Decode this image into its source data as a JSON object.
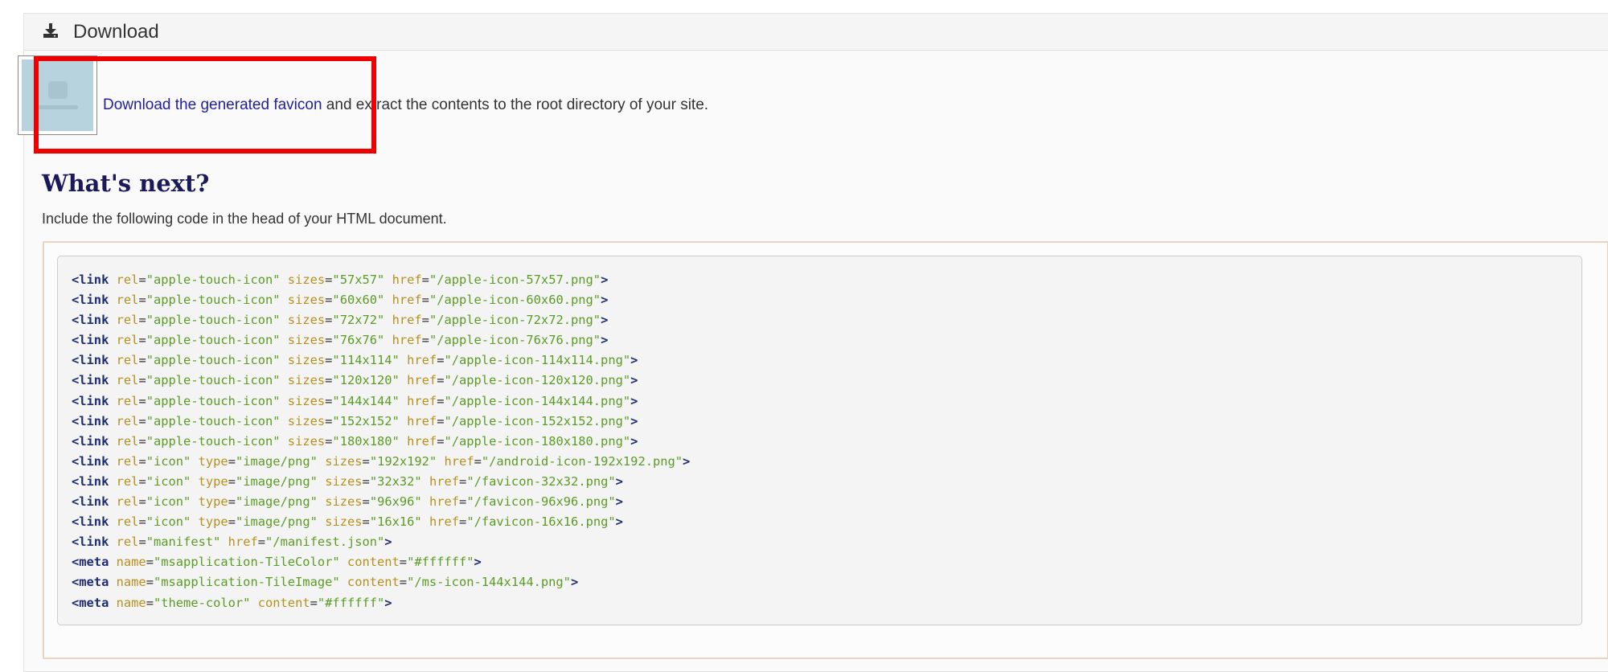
{
  "panel": {
    "icon": "download-icon",
    "title": "Download"
  },
  "download": {
    "link_text": "Download the generated favicon",
    "rest_text": " and extract the contents to the root directory of your site.",
    "thumbnail": "favicon-package-thumbnail"
  },
  "next": {
    "heading": "What's next?",
    "intro": "Include the following code in the head of your HTML document."
  },
  "code_lines": [
    {
      "tag": "link",
      "attrs": [
        [
          "rel",
          "apple-touch-icon"
        ],
        [
          "sizes",
          "57x57"
        ],
        [
          "href",
          "/apple-icon-57x57.png"
        ]
      ]
    },
    {
      "tag": "link",
      "attrs": [
        [
          "rel",
          "apple-touch-icon"
        ],
        [
          "sizes",
          "60x60"
        ],
        [
          "href",
          "/apple-icon-60x60.png"
        ]
      ]
    },
    {
      "tag": "link",
      "attrs": [
        [
          "rel",
          "apple-touch-icon"
        ],
        [
          "sizes",
          "72x72"
        ],
        [
          "href",
          "/apple-icon-72x72.png"
        ]
      ]
    },
    {
      "tag": "link",
      "attrs": [
        [
          "rel",
          "apple-touch-icon"
        ],
        [
          "sizes",
          "76x76"
        ],
        [
          "href",
          "/apple-icon-76x76.png"
        ]
      ]
    },
    {
      "tag": "link",
      "attrs": [
        [
          "rel",
          "apple-touch-icon"
        ],
        [
          "sizes",
          "114x114"
        ],
        [
          "href",
          "/apple-icon-114x114.png"
        ]
      ]
    },
    {
      "tag": "link",
      "attrs": [
        [
          "rel",
          "apple-touch-icon"
        ],
        [
          "sizes",
          "120x120"
        ],
        [
          "href",
          "/apple-icon-120x120.png"
        ]
      ]
    },
    {
      "tag": "link",
      "attrs": [
        [
          "rel",
          "apple-touch-icon"
        ],
        [
          "sizes",
          "144x144"
        ],
        [
          "href",
          "/apple-icon-144x144.png"
        ]
      ]
    },
    {
      "tag": "link",
      "attrs": [
        [
          "rel",
          "apple-touch-icon"
        ],
        [
          "sizes",
          "152x152"
        ],
        [
          "href",
          "/apple-icon-152x152.png"
        ]
      ]
    },
    {
      "tag": "link",
      "attrs": [
        [
          "rel",
          "apple-touch-icon"
        ],
        [
          "sizes",
          "180x180"
        ],
        [
          "href",
          "/apple-icon-180x180.png"
        ]
      ]
    },
    {
      "tag": "link",
      "attrs": [
        [
          "rel",
          "icon"
        ],
        [
          "type",
          "image/png"
        ],
        [
          "sizes",
          "192x192"
        ],
        [
          "href",
          "/android-icon-192x192.png"
        ]
      ]
    },
    {
      "tag": "link",
      "attrs": [
        [
          "rel",
          "icon"
        ],
        [
          "type",
          "image/png"
        ],
        [
          "sizes",
          "32x32"
        ],
        [
          "href",
          "/favicon-32x32.png"
        ]
      ]
    },
    {
      "tag": "link",
      "attrs": [
        [
          "rel",
          "icon"
        ],
        [
          "type",
          "image/png"
        ],
        [
          "sizes",
          "96x96"
        ],
        [
          "href",
          "/favicon-96x96.png"
        ]
      ]
    },
    {
      "tag": "link",
      "attrs": [
        [
          "rel",
          "icon"
        ],
        [
          "type",
          "image/png"
        ],
        [
          "sizes",
          "16x16"
        ],
        [
          "href",
          "/favicon-16x16.png"
        ]
      ]
    },
    {
      "tag": "link",
      "attrs": [
        [
          "rel",
          "manifest"
        ],
        [
          "href",
          "/manifest.json"
        ]
      ]
    },
    {
      "tag": "meta",
      "attrs": [
        [
          "name",
          "msapplication-TileColor"
        ],
        [
          "content",
          "#ffffff"
        ]
      ]
    },
    {
      "tag": "meta",
      "attrs": [
        [
          "name",
          "msapplication-TileImage"
        ],
        [
          "content",
          "/ms-icon-144x144.png"
        ]
      ]
    },
    {
      "tag": "meta",
      "attrs": [
        [
          "name",
          "theme-color"
        ],
        [
          "content",
          "#ffffff"
        ]
      ]
    }
  ],
  "colors": {
    "highlight_border": "#ee0000",
    "link": "#1f1fa0",
    "heading": "#1a1a5a",
    "code_tag": "#1e2d74",
    "code_attr": "#b8901e",
    "code_value": "#5b9c25"
  }
}
